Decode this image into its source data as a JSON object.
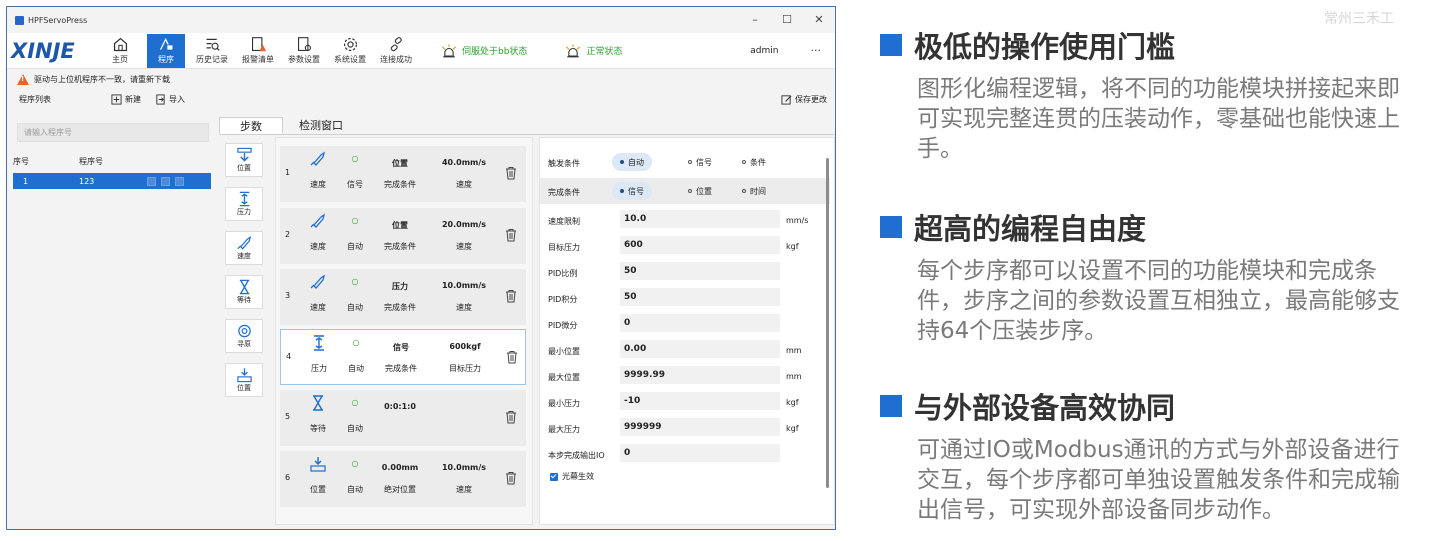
{
  "window": {
    "title": "HPFServoPress",
    "controls": [
      "–",
      "☐",
      "✕"
    ]
  },
  "toolbar": {
    "logo": "XINJE",
    "items": [
      {
        "label": "主页",
        "icon": "home-icon",
        "active": false
      },
      {
        "label": "程序",
        "icon": "program-icon",
        "active": true
      },
      {
        "label": "历史记录",
        "icon": "history-icon",
        "active": false
      },
      {
        "label": "报警清单",
        "icon": "alarm-list-icon",
        "active": false
      },
      {
        "label": "参数设置",
        "icon": "param-settings-icon",
        "active": false
      },
      {
        "label": "系统设置",
        "icon": "gear-icon",
        "active": false
      },
      {
        "label": "连接成功",
        "icon": "link-icon",
        "active": false
      }
    ],
    "status1": "伺服处于bb状态",
    "status2": "正常状态",
    "user": "admin",
    "more": "···",
    "status_color": "#2aa22a"
  },
  "warning": "驱动与上位机程序不一致，请重新下载",
  "program_list": {
    "label": "程序列表",
    "new": "新建",
    "import": "导入",
    "save": "保存更改",
    "search_placeholder": "请输入程序号",
    "col_no": "序号",
    "col_name": "程序号",
    "rows": [
      {
        "no": "1",
        "name": "123"
      }
    ]
  },
  "tabs": [
    "步数",
    "检测窗口"
  ],
  "palette": [
    {
      "label": "位置",
      "icon": "position-icon"
    },
    {
      "label": "压力",
      "icon": "pressure-icon"
    },
    {
      "label": "速度",
      "icon": "speed-icon"
    },
    {
      "label": "等待",
      "icon": "hourglass-icon"
    },
    {
      "label": "寻原",
      "icon": "home-search-icon"
    },
    {
      "label": "位置",
      "icon": "position-icon"
    }
  ],
  "steps": [
    {
      "no": "1",
      "type": "速度",
      "trigger": "信号",
      "value3": "位置",
      "label3": "完成条件",
      "value4": "40.0mm/s",
      "label4": "速度",
      "icon": "speed-icon"
    },
    {
      "no": "2",
      "type": "速度",
      "trigger": "自动",
      "value3": "位置",
      "label3": "完成条件",
      "value4": "20.0mm/s",
      "label4": "速度",
      "icon": "speed-icon"
    },
    {
      "no": "3",
      "type": "速度",
      "trigger": "自动",
      "value3": "压力",
      "label3": "完成条件",
      "value4": "10.0mm/s",
      "label4": "速度",
      "icon": "speed-icon"
    },
    {
      "no": "4",
      "type": "压力",
      "trigger": "自动",
      "value3": "信号",
      "label3": "完成条件",
      "value4": "600kgf",
      "label4": "目标压力",
      "icon": "pressure-icon"
    },
    {
      "no": "5",
      "type": "等待",
      "trigger": "自动",
      "value3": "0:0:1:0",
      "label3": "",
      "value4": "",
      "label4": "",
      "icon": "hourglass-icon"
    },
    {
      "no": "6",
      "type": "位置",
      "trigger": "自动",
      "value3": "0.00mm",
      "label3": "绝对位置",
      "value4": "10.0mm/s",
      "label4": "速度",
      "icon": "position-icon"
    }
  ],
  "properties": {
    "trigger_label": "触发条件",
    "trigger_options": [
      "自动",
      "信号",
      "条件"
    ],
    "complete_label": "完成条件",
    "complete_options": [
      "信号",
      "位置",
      "时间"
    ],
    "fields": [
      {
        "label": "速度限制",
        "value": "10.0",
        "unit": "mm/s"
      },
      {
        "label": "目标压力",
        "value": "600",
        "unit": "kgf"
      },
      {
        "label": "PID比例",
        "value": "50",
        "unit": ""
      },
      {
        "label": "PID积分",
        "value": "50",
        "unit": ""
      },
      {
        "label": "PID微分",
        "value": "0",
        "unit": ""
      },
      {
        "label": "最小位置",
        "value": "0.00",
        "unit": "mm"
      },
      {
        "label": "最大位置",
        "value": "9999.99",
        "unit": "mm"
      },
      {
        "label": "最小压力",
        "value": "-10",
        "unit": "kgf"
      },
      {
        "label": "最大压力",
        "value": "999999",
        "unit": "kgf"
      },
      {
        "label": "本步完成输出IO",
        "value": "0",
        "unit": ""
      }
    ],
    "checkbox": "光幕生效"
  },
  "watermark": "常州三禾工",
  "features": [
    {
      "title": "极低的操作使用门槛",
      "body": "图形化编程逻辑，将不同的功能模块拼接起来即可实现完整连贯的压装动作，零基础也能快速上手。"
    },
    {
      "title": "超高的编程自由度",
      "body": "每个步序都可以设置不同的功能模块和完成条件，步序之间的参数设置互相独立，最高能够支持64个压装步序。"
    },
    {
      "title": "与外部设备高效协同",
      "body": "可通过IO或Modbus通讯的方式与外部设备进行交互，每个步序都可单独设置触发条件和完成输出信号，可实现外部设备同步动作。"
    }
  ],
  "accent_color": "#1f6fd0"
}
